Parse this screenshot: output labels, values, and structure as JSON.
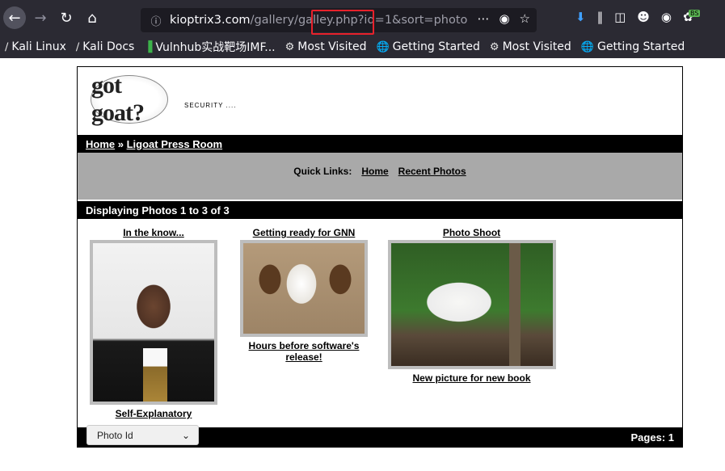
{
  "browser": {
    "url_host": "kioptrix3.com",
    "url_path_a": "/gallery/galle",
    "url_path_b": "y.php?id=1",
    "url_path_c": "&sort=photo",
    "bookmarks": [
      {
        "label": "Kali Linux",
        "icon": "kali-dragon-icon"
      },
      {
        "label": "Kali Docs",
        "icon": "kali-dragon-icon"
      },
      {
        "label": "Vulnhub实战靶场IMF...",
        "icon": "vulnhub-icon"
      },
      {
        "label": "Most Visited",
        "icon": "gear-icon"
      },
      {
        "label": "Getting Started",
        "icon": "globe-icon"
      },
      {
        "label": "Most Visited",
        "icon": "gear-icon"
      },
      {
        "label": "Getting Started",
        "icon": "globe-icon"
      }
    ],
    "extension_badge": "BS",
    "highlight_color": "#e8212b"
  },
  "site": {
    "logo_text": "got goat?",
    "tagline": "SECURITY ....",
    "breadcrumb": {
      "home": "Home",
      "separator": "»",
      "section": "Ligoat Press Room"
    },
    "quick_links": {
      "label": "Quick Links:",
      "home": "Home",
      "recent": "Recent Photos"
    },
    "display_text": "Displaying Photos 1 to 3 of 3",
    "photos": [
      {
        "title": "In the know...",
        "caption": "Self-Explanatory"
      },
      {
        "title": "Getting ready for GNN",
        "caption": "Hours before software's release!"
      },
      {
        "title": "Photo Shoot",
        "caption": "New picture for new book"
      }
    ],
    "pages_text": "Pages: 1",
    "sort_select": {
      "selected": "Photo Id"
    }
  }
}
